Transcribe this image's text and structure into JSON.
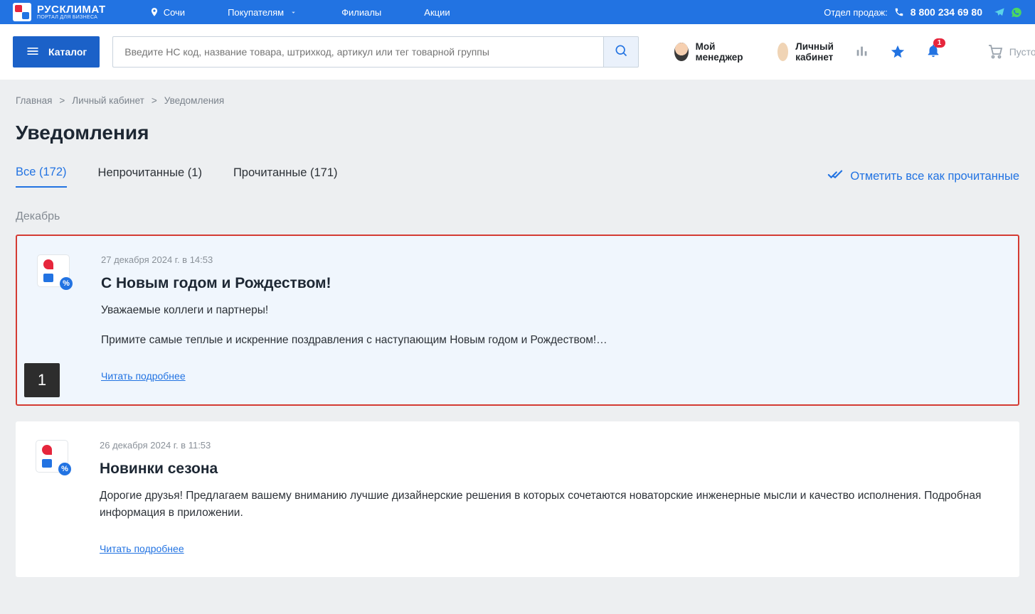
{
  "topbar": {
    "logo_main": "РУСКЛИМАТ",
    "logo_sub": "ПОРТАЛ ДЛЯ БИЗНЕСА",
    "city": "Сочи",
    "nav_buyers": "Покупателям",
    "nav_branches": "Филиалы",
    "nav_promo": "Акции",
    "sales_label": "Отдел продаж:",
    "phone": "8 800 234 69 80"
  },
  "header": {
    "catalog": "Каталог",
    "search_placeholder": "Введите НС код, название товара, штрихкод, артикул или тег товарной группы",
    "manager": "Мой менеджер",
    "account": "Личный кабинет",
    "badge_count": "1",
    "cart_empty": "Пусто"
  },
  "crumbs": {
    "c0": "Главная",
    "c1": "Личный кабинет",
    "c2": "Уведомления"
  },
  "page_title": "Уведомления",
  "tabs": {
    "all": "Все (172)",
    "unread": "Непрочитанные (1)",
    "read": "Прочитанные (171)",
    "mark_all": "Отметить все как прочитанные"
  },
  "month": "Декабрь",
  "cards": [
    {
      "date": "27 декабря 2024 г. в 14:53",
      "title": "С Новым годом и Рождеством!",
      "line1": "Уважаемые коллеги и партнеры!",
      "line2": "Примите самые теплые и искренние поздравления с наступающим Новым годом и Рождеством!…",
      "more": "Читать подробнее",
      "tag": "1"
    },
    {
      "date": "26 декабря 2024 г. в 11:53",
      "title": "Новинки сезона",
      "line1": "Дорогие друзья! Предлагаем вашему вниманию лучшие дизайнерские решения в которых сочетаются новаторские инженерные мысли и качество исполнения. Подробная информация в приложении.",
      "line2": "",
      "more": "Читать подробнее"
    }
  ]
}
